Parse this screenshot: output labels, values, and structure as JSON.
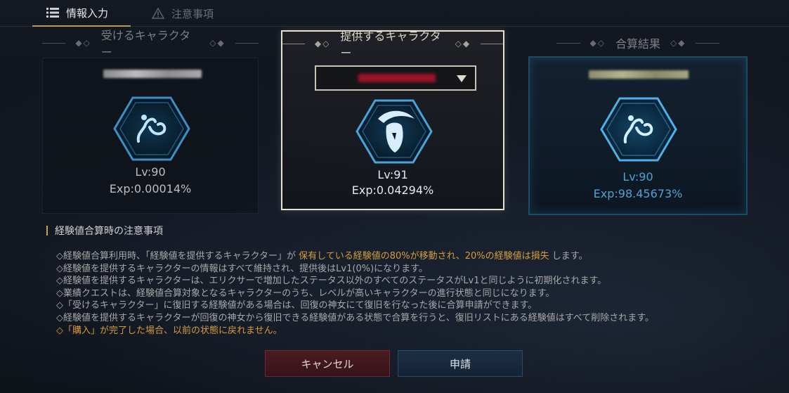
{
  "tabs": [
    {
      "label": "情報入力",
      "icon": "list-icon",
      "active": true
    },
    {
      "label": "注意事項",
      "icon": "warning-icon",
      "active": false
    }
  ],
  "columns": {
    "receiving": {
      "header": "受けるキャラクター",
      "class_icon": "sorcerer-class-icon",
      "lv": "Lv:90",
      "exp": "Exp:0.00014%"
    },
    "providing": {
      "header": "提供するキャラクター",
      "class_icon": "reaper-class-icon",
      "lv": "Lv:91",
      "exp": "Exp:0.04294%"
    },
    "result": {
      "header": "合算結果",
      "class_icon": "sorcerer-class-icon",
      "lv": "Lv:90",
      "exp": "Exp:98.45673%"
    }
  },
  "notice": {
    "title": "経験値合算時の注意事項",
    "line1_a": "◇経験値合算利用時、「経験値を提供するキャラクター」が ",
    "line1_hl": "保有している経験値の80%が移動され、20%の経験値は損失",
    "line1_b": " します。",
    "line2": "◇経験値を提供するキャラクターの情報はすべて維持され、提供後はLv1(0%)になります。",
    "line3": "◇経験値を提供するキャラクターは、エリクサーで増加したステータス以外のすべてのステータスがLv1と同じように初期化されます。",
    "line4": "◇業績クエストは、経験値合算対象となるキャラクターのうち、レベルが高いキャラクターの進行状態と同じになります。",
    "line5": "◇「受けるキャラクター」に復旧する経験値がある場合は、回復の神女にて復旧を行なった後に合算申請ができます。",
    "line6": "◇経験値を提供するキャラクターが回復の神女から復旧できる経験値がある状態で合算を行うと、復旧リストにある経験値はすべて削除されます。",
    "line7": "◇「購入」が完了した場合、以前の状態に戻れません。"
  },
  "buttons": {
    "cancel": "キャンセル",
    "apply": "申請"
  },
  "colors": {
    "accent_gold": "#c7a35a",
    "highlight_orange": "#d49d3c",
    "result_blue": "#4fa3d1",
    "cancel_red": "#4a1c22",
    "apply_blue": "#1b2f44"
  }
}
